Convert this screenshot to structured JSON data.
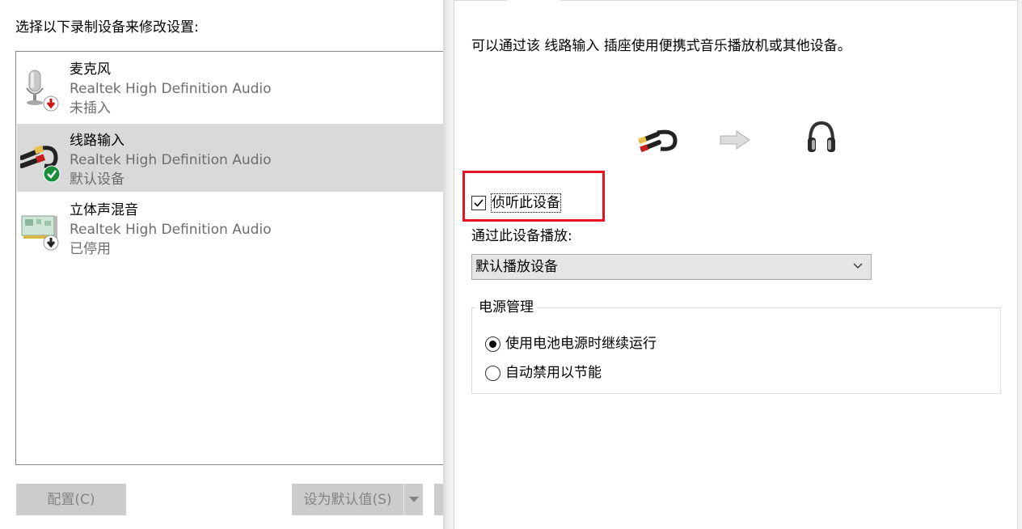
{
  "recording_panel": {
    "instruction": "选择以下录制设备来修改设置:",
    "devices": [
      {
        "name": "麦克风",
        "driver": "Realtek High Definition Audio",
        "status": "未插入",
        "icon": "microphone-icon",
        "badge": "unplugged-badge-icon",
        "selected": false
      },
      {
        "name": "线路输入",
        "driver": "Realtek High Definition Audio",
        "status": "默认设备",
        "icon": "line-in-cable-icon",
        "badge": "default-checkmark-badge-icon",
        "selected": true
      },
      {
        "name": "立体声混音",
        "driver": "Realtek High Definition Audio",
        "status": "已停用",
        "icon": "sound-card-icon",
        "badge": "disabled-badge-icon",
        "selected": false
      }
    ],
    "buttons": {
      "configure": "配置(C)",
      "set_default": "设为默认值(S)"
    }
  },
  "properties": {
    "description": "可以通过该 线路输入 插座使用便携式音乐播放机或其他设备。",
    "listen_checkbox": {
      "label": "侦听此设备",
      "checked": true
    },
    "playback_label": "通过此设备播放:",
    "playback_select": {
      "value": "默认播放设备"
    },
    "power_group": {
      "title": "电源管理",
      "options": [
        {
          "label": "使用电池电源时继续运行",
          "selected": true
        },
        {
          "label": "自动禁用以节能",
          "selected": false
        }
      ]
    }
  },
  "colors": {
    "highlight_box": "#e81224",
    "selected_row": "#d9d9d9",
    "disabled_button": "#cccccc"
  }
}
